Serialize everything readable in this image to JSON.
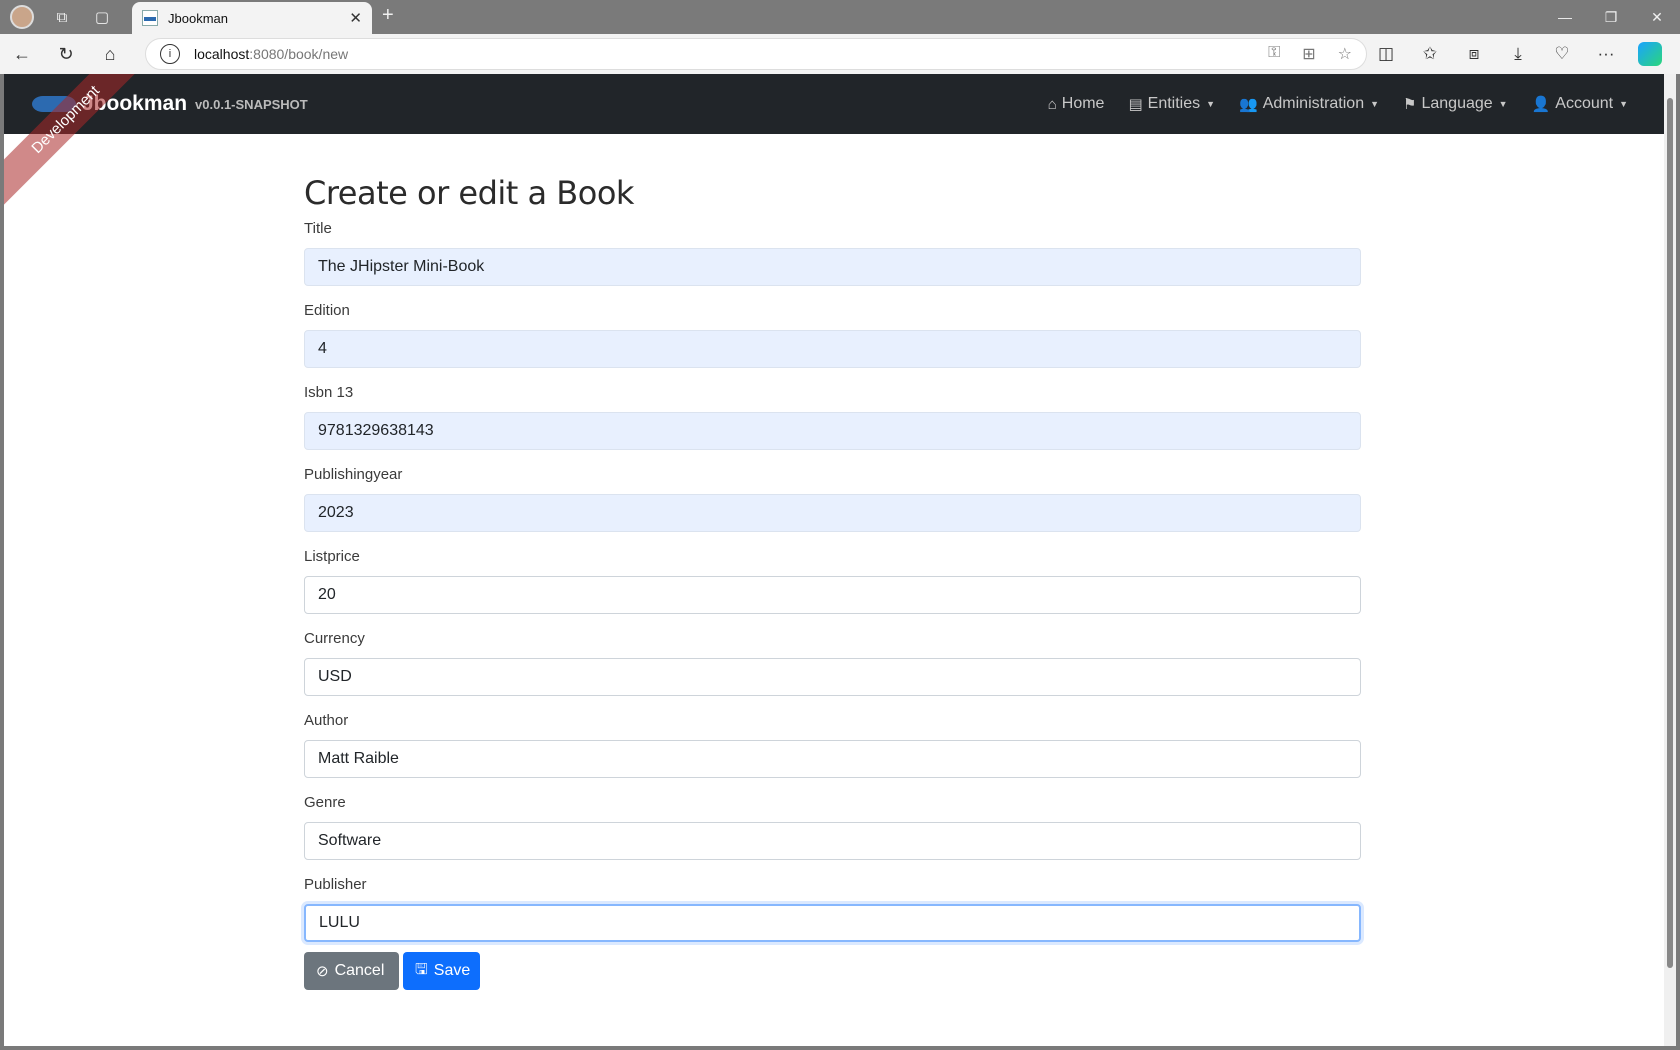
{
  "browser": {
    "tab_title": "Jbookman",
    "url_host": "localhost",
    "url_path": ":8080/book/new"
  },
  "app": {
    "brand_title": "Jbookman",
    "brand_version": "v0.0.1-SNAPSHOT",
    "ribbon": "Development",
    "nav": [
      {
        "label": "Home",
        "icon": "home-icon"
      },
      {
        "label": "Entities",
        "icon": "table-icon"
      },
      {
        "label": "Administration",
        "icon": "users-icon"
      },
      {
        "label": "Language",
        "icon": "flag-icon"
      },
      {
        "label": "Account",
        "icon": "user-icon"
      }
    ]
  },
  "form": {
    "title": "Create or edit a Book",
    "fields": [
      {
        "label": "Title",
        "value": "The JHipster Mini-Book"
      },
      {
        "label": "Edition",
        "value": "4"
      },
      {
        "label": "Isbn 13",
        "value": "9781329638143"
      },
      {
        "label": "Publishingyear",
        "value": "2023"
      },
      {
        "label": "Listprice",
        "value": "20"
      },
      {
        "label": "Currency",
        "value": "USD"
      },
      {
        "label": "Author",
        "value": "Matt Raible"
      },
      {
        "label": "Genre",
        "value": "Software"
      },
      {
        "label": "Publisher",
        "value": "LULU"
      }
    ],
    "cancel_label": "Cancel",
    "save_label": "Save"
  },
  "colors": {
    "navbar": "#212529",
    "save": "#0d6efd",
    "cancel": "#6c757d",
    "autofill": "#e8f0fe"
  }
}
